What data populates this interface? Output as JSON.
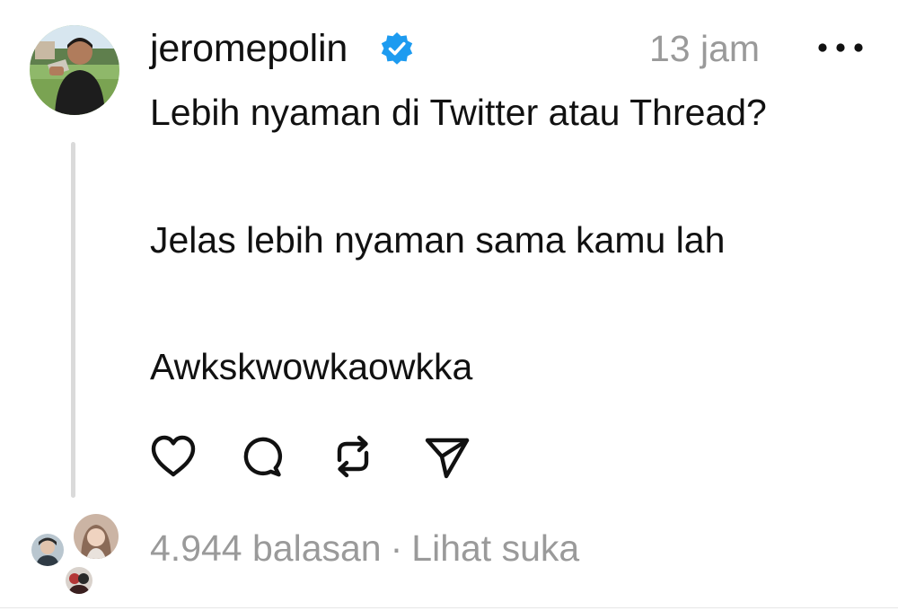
{
  "post": {
    "author": {
      "username": "jeromepolin",
      "verified": true,
      "verified_color": "#1d9bf0"
    },
    "timestamp": "13 jam",
    "more_icon": "more-horizontal-icon",
    "text_lines": [
      "Lebih nyaman di Twitter atau Thread?",
      "Jelas lebih nyaman sama kamu lah",
      "Awkskwowkaowkka"
    ],
    "actions": [
      {
        "name": "like",
        "icon": "heart-icon"
      },
      {
        "name": "reply",
        "icon": "comment-icon"
      },
      {
        "name": "repost",
        "icon": "repost-icon"
      },
      {
        "name": "share",
        "icon": "send-icon"
      }
    ],
    "replies": {
      "count_label": "4.944 balasan",
      "separator": "·",
      "likes_label": "Lihat suka"
    }
  },
  "colors": {
    "primary_text": "#111111",
    "secondary_text": "#9a9a9a",
    "thread_line": "#dadada"
  }
}
